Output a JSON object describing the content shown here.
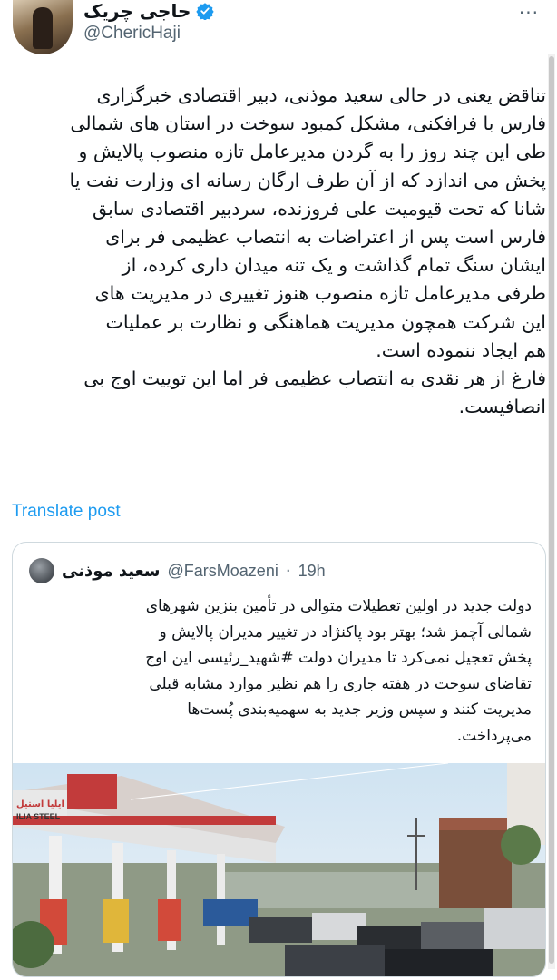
{
  "author": {
    "display_name": "حاجی چریک",
    "handle": "@ChericHaji",
    "avatar_icon": "avatar-photo",
    "verified_icon": "verified-badge-icon"
  },
  "more_icon": "more-icon",
  "tweet": {
    "lines": [
      "تناقض یعنی در حالی سعید موذنی، دبیر اقتصادی خبرگزاری",
      "فارس با فرافکنی، مشکل کمبود سوخت در استان های شمالی",
      "طی این چند روز را به گردن مدیرعامل تازه منصوب پالایش و",
      "پخش می اندازد که از آن طرف ارگان رسانه ای وزارت نفت یا",
      "شانا که تحت قیومیت علی فروزنده، سردبیر اقتصادی سابق",
      "فارس است پس از اعتراضات به انتصاب عظیمی فر برای",
      "ایشان سنگ تمام گذاشت و یک تنه میدان داری کرده، از",
      "طرفی مدیرعامل تازه منصوب هنوز تغییری در مدیریت های",
      "این شرکت همچون مدیریت هماهنگی و نظارت بر عملیات",
      "هم ایجاد ننموده است.",
      "فارغ از هر نقدی به انتصاب عظیمی فر اما این توییت اوج بی",
      "انصافیست."
    ]
  },
  "translate_label": "Translate post",
  "quoted": {
    "display_name": "سعید موذنی",
    "handle": "@FarsMoazeni",
    "separator": "·",
    "time": "19h",
    "lines": [
      "دولت جدید در اولین تعطیلات متوالی در تأمین بنزین شهرهای",
      "شمالی آچمز شد؛ بهتر بود پاکنژاد در تغییر مدیران پالایش و",
      "پخش تعجیل نمی‌کرد تا مدیران دولت #شهید_رئیسی این اوج",
      "تقاضای سوخت در هفته جاری را هم نظیر موارد مشابه قبلی",
      "مدیریت کنند و سپس وزیر جدید به سهمیه‌بندی پُست‌ها",
      "می‌پرداخت."
    ],
    "image": {
      "description_icon": "gas-station-photo",
      "sign_text": "ایلیا استیل",
      "sign_text_latin": "ILIA STEEL"
    }
  }
}
